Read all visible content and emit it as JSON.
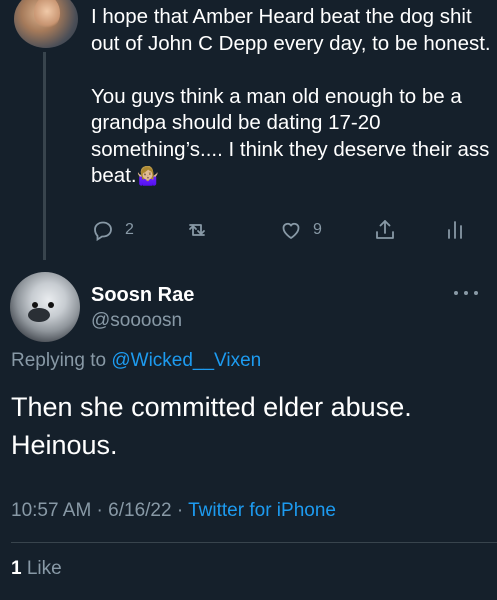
{
  "parent_tweet": {
    "paragraphs": [
      "I hope that Amber Heard beat the dog shit out of John C Depp every day, to be honest.",
      "You guys think a man old enough to be a grandpa should be dating 17-20 something’s.... I think they deserve their ass beat."
    ],
    "emoji": "🤷🏼‍♀️",
    "actions": {
      "reply_count": "2",
      "retweet_count": "",
      "like_count": "9"
    }
  },
  "reply_tweet": {
    "display_name": "Soosn Rae",
    "handle": "@soooosn",
    "replying_to_label": "Replying to",
    "replying_to_handle": "@Wicked__Vixen",
    "text_line1": "Then she committed elder abuse.",
    "text_line2": "Heinous.",
    "time": "10:57 AM",
    "date": "6/16/22",
    "separator": " · ",
    "source": "Twitter for iPhone",
    "like_count": "1",
    "like_label": "Like"
  },
  "colors": {
    "background": "#15202b",
    "text_primary": "#ffffff",
    "text_secondary": "#8899a6",
    "accent": "#1d9bf0",
    "divider": "#38444d"
  },
  "icons": [
    "reply-icon",
    "retweet-icon",
    "heart-icon",
    "share-icon",
    "analytics-icon",
    "more-icon"
  ]
}
